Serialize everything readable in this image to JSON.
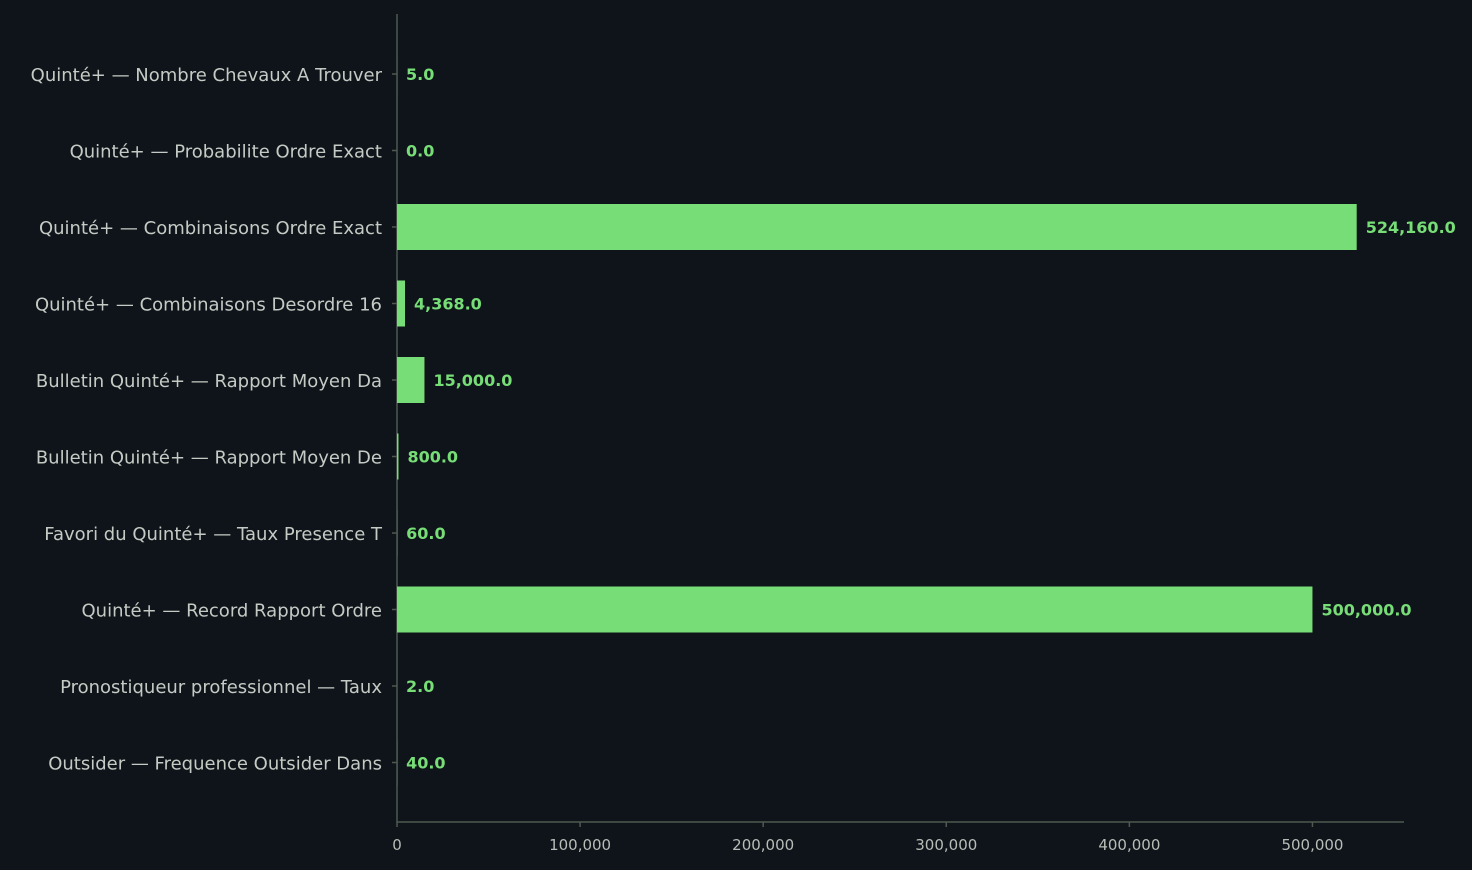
{
  "colors": {
    "background": "#0f141a",
    "bar": "#77dd77",
    "axis": "#4f5a4f",
    "category_text": "#c4cbc4",
    "tick_text": "#b7bdb7"
  },
  "chart_data": {
    "type": "bar",
    "orientation": "horizontal",
    "title": "",
    "xlabel": "",
    "ylabel": "",
    "xlim": [
      0,
      550000
    ],
    "grid": false,
    "legend": "none",
    "categories": [
      "Quinté+ — Nombre Chevaux A Trouver",
      "Quinté+ — Probabilite Ordre Exact",
      "Quinté+ — Combinaisons Ordre Exact",
      "Quinté+ — Combinaisons Desordre 16",
      "Bulletin Quinté+ — Rapport Moyen Da",
      "Bulletin Quinté+ — Rapport Moyen De",
      "Favori du Quinté+ — Taux Presence T",
      "Quinté+ — Record Rapport Ordre",
      "Pronostiqueur professionnel — Taux",
      "Outsider — Frequence Outsider Dans"
    ],
    "values": [
      5.0,
      0.0,
      524160.0,
      4368.0,
      15000.0,
      800.0,
      60.0,
      500000.0,
      2.0,
      40.0
    ],
    "value_labels": [
      "5.0",
      "0.0",
      "524,160.0",
      "4,368.0",
      "15,000.0",
      "800.0",
      "60.0",
      "500,000.0",
      "2.0",
      "40.0"
    ],
    "x_ticks": [
      0,
      100000,
      200000,
      300000,
      400000,
      500000
    ],
    "x_tick_labels": [
      "0",
      "100,000",
      "200,000",
      "300,000",
      "400,000",
      "500,000"
    ]
  }
}
